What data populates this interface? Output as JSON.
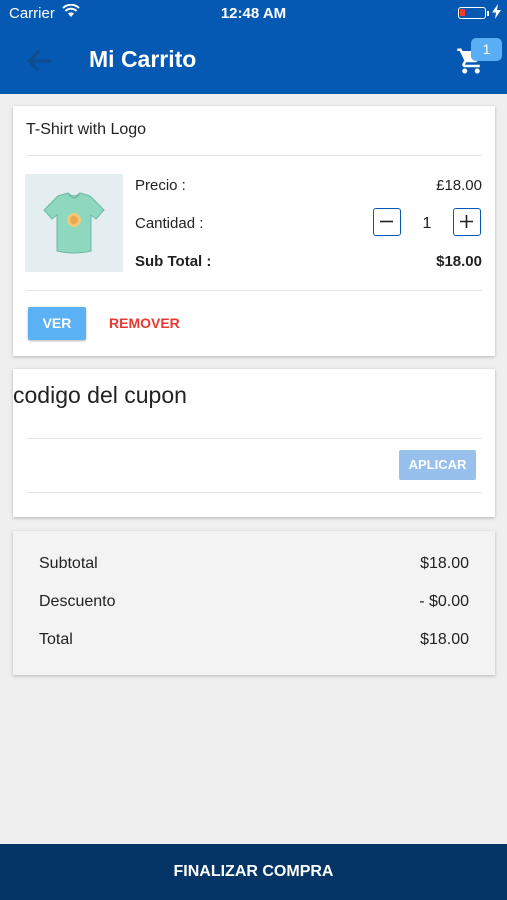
{
  "status_bar": {
    "carrier": "Carrier",
    "time": "12:48 AM"
  },
  "app_bar": {
    "title": "Mi Carrito",
    "cart_badge": "1"
  },
  "cart_item": {
    "name": "T-Shirt with Logo",
    "price_label": "Precio :",
    "price_value": "£18.00",
    "quantity_label": "Cantidad :",
    "quantity": "1",
    "subtotal_label": "Sub Total :",
    "subtotal_value": "$18.00",
    "view_button": "VER",
    "remove_button": "REMOVER"
  },
  "coupon": {
    "label": "codigo del cupon",
    "apply_button": "APLICAR"
  },
  "summary": {
    "subtotal_label": "Subtotal",
    "subtotal_value": "$18.00",
    "discount_label": "Descuento",
    "discount_value": "- $0.00",
    "total_label": "Total",
    "total_value": "$18.00"
  },
  "checkout_button": "FINALIZAR COMPRA",
  "colors": {
    "primary": "#0659b3",
    "accent": "#5ab2f5",
    "danger": "#e83a33",
    "checkout": "#053566"
  }
}
